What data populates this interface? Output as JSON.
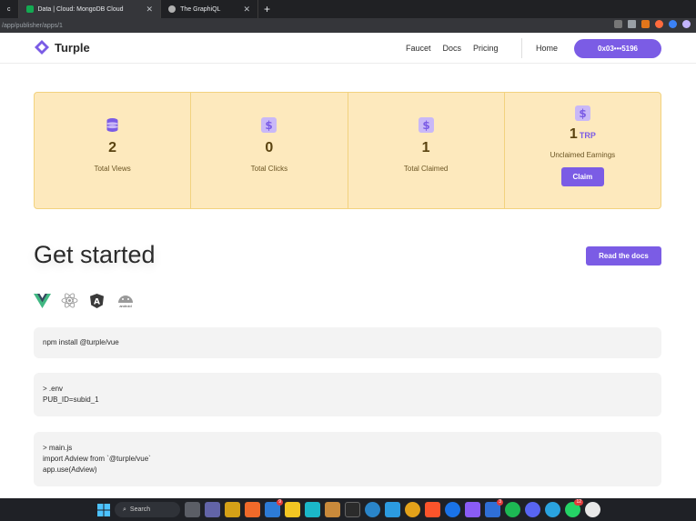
{
  "browser": {
    "tabs": [
      {
        "title": "Data | Cloud: MongoDB Cloud",
        "close": "✕",
        "color": "#13aa52"
      },
      {
        "title": "The GraphiQL",
        "close": "✕",
        "color": "#e8eaed"
      }
    ],
    "new_tab": "+",
    "tab_prefix": "c",
    "url": "/app/publisher/apps/1"
  },
  "nav": {
    "brand": "Turple",
    "links": [
      "Faucet",
      "Docs",
      "Pricing"
    ],
    "home": "Home",
    "wallet": "0x03•••5196"
  },
  "stats": [
    {
      "icon": "database-icon",
      "value": "2",
      "label": "Total Views"
    },
    {
      "icon": "dollar-icon",
      "value": "0",
      "label": "Total Clicks"
    },
    {
      "icon": "dollar-icon",
      "value": "1",
      "label": "Total Claimed"
    }
  ],
  "earnings": {
    "value": "1",
    "unit": "TRP",
    "label": "Unclaimed Earnings",
    "claim": "Claim"
  },
  "get_started": {
    "title": "Get started",
    "docs_button": "Read the docs"
  },
  "frameworks": [
    "vue-icon",
    "react-icon",
    "angular-icon",
    "android-icon"
  ],
  "android_label": "android",
  "code": {
    "install": "npm install @turple/vue",
    "env_header": "> .env",
    "env_line": "PUB_ID=subid_1",
    "main_header": "> main.js",
    "main_line1": "import Adview from `@turple/vue`",
    "main_line2": "app.use(Adview)"
  },
  "taskbar": {
    "search": "Search",
    "badges": {
      "mail": "9",
      "todo": "3",
      "whatsapp": "12"
    }
  },
  "colors": {
    "accent": "#7b5ce5",
    "stat_bg": "#fde9bd",
    "stat_border": "#f2d27f"
  }
}
